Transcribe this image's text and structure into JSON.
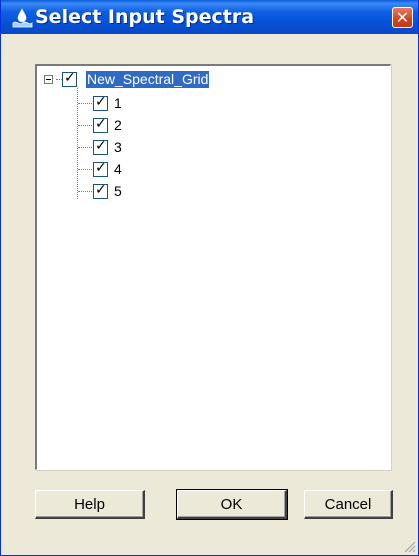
{
  "window": {
    "title": "Select Input Spectra",
    "icon": "water-drop-icon",
    "close_glyph": "✕"
  },
  "tree": {
    "root": {
      "label": "New_Spectral_Grid",
      "checked": true,
      "expanded": true,
      "selected": true
    },
    "children": [
      {
        "label": "1",
        "checked": true
      },
      {
        "label": "2",
        "checked": true
      },
      {
        "label": "3",
        "checked": true
      },
      {
        "label": "4",
        "checked": true
      },
      {
        "label": "5",
        "checked": true
      }
    ],
    "check_glyph": "✓"
  },
  "buttons": {
    "help": "Help",
    "ok": "OK",
    "cancel": "Cancel"
  },
  "colors": {
    "titlebar": "#0551d6",
    "selection": "#316ac5",
    "close": "#d2431d",
    "dialog_bg": "#ece9d8"
  }
}
